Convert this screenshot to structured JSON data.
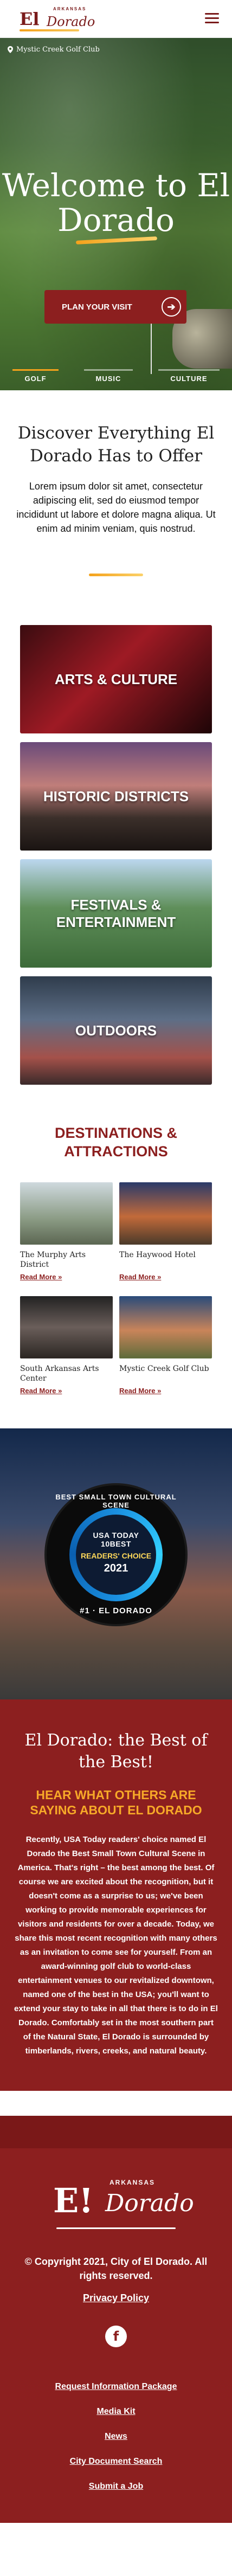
{
  "header": {
    "logo": {
      "state": "ARKANSAS",
      "el": "El",
      "dorado": "Dorado"
    },
    "menu_icon": "hamburger-menu-icon"
  },
  "hero": {
    "location": "Mystic Creek Golf Club",
    "title": "Welcome to El Dorado",
    "cta_label": "PLAN YOUR VISIT",
    "tabs": [
      {
        "label": "GOLF",
        "active": true
      },
      {
        "label": "MUSIC",
        "active": false
      },
      {
        "label": "CULTURE",
        "active": false
      }
    ]
  },
  "discover": {
    "title": "Discover Everything El Dorado Has to Offer",
    "body": "Lorem ipsum dolor sit amet, consectetur adipiscing elit, sed do eiusmod tempor incididunt ut labore et dolore magna aliqua. Ut enim ad minim veniam, quis nostrud."
  },
  "categories": [
    {
      "label": "ARTS & CULTURE"
    },
    {
      "label": "HISTORIC DISTRICTS"
    },
    {
      "label": "FESTIVALS & ENTERTAINMENT"
    },
    {
      "label": "OUTDOORS"
    }
  ],
  "destinations": {
    "title": "DESTINATIONS & ATTRACTIONS",
    "read_more": "Read More »",
    "items": [
      {
        "name": "The Murphy Arts District"
      },
      {
        "name": "The Haywood Hotel"
      },
      {
        "name": "South Arkansas Arts Center"
      },
      {
        "name": "Mystic Creek Golf Club"
      }
    ]
  },
  "badge": {
    "top_text": "BEST SMALL TOWN CULTURAL SCENE",
    "brand": "USA TODAY",
    "sub": "10BEST",
    "award": "READERS' CHOICE",
    "year": "2021",
    "bottom_text": "#1 · EL DORADO"
  },
  "best": {
    "title": "El Dorado: the Best of the Best!",
    "subtitle": "HEAR WHAT OTHERS ARE SAYING ABOUT EL DORADO",
    "body_lead": "Recently,",
    "body_highlight": "USA Today",
    "body_rest": " readers' choice named El Dorado the Best Small Town Cultural Scene in America. That's right – the best among the best. Of course we are excited about the recognition, but it doesn't come as a surprise to us; we've been working to provide memorable experiences for visitors and residents for over a decade. Today, we share this most recent recognition with many others as an invitation to come see for yourself.  From an award-winning golf club to world-class entertainment venues to our revitalized downtown, named one of the best in the USA; you'll want to extend your stay to take in all that there is to do in El Dorado. Comfortably set in the most southern part of the Natural State, El Dorado is surrounded by timberlands, rivers, creeks, and natural beauty."
  },
  "footer": {
    "logo": {
      "state": "ARKANSAS",
      "el": "E!",
      "dorado": "Dorado"
    },
    "copyright": "© Copyright 2021, City of El Dorado. All rights reserved.",
    "privacy": "Privacy Policy",
    "facebook_icon": "facebook-icon",
    "links": [
      "Request Information Package",
      "Media Kit",
      "News",
      "City Document Search",
      "Submit a Job"
    ]
  },
  "colors": {
    "brand": "#8c1f1f",
    "accent": "#f4a21b"
  }
}
